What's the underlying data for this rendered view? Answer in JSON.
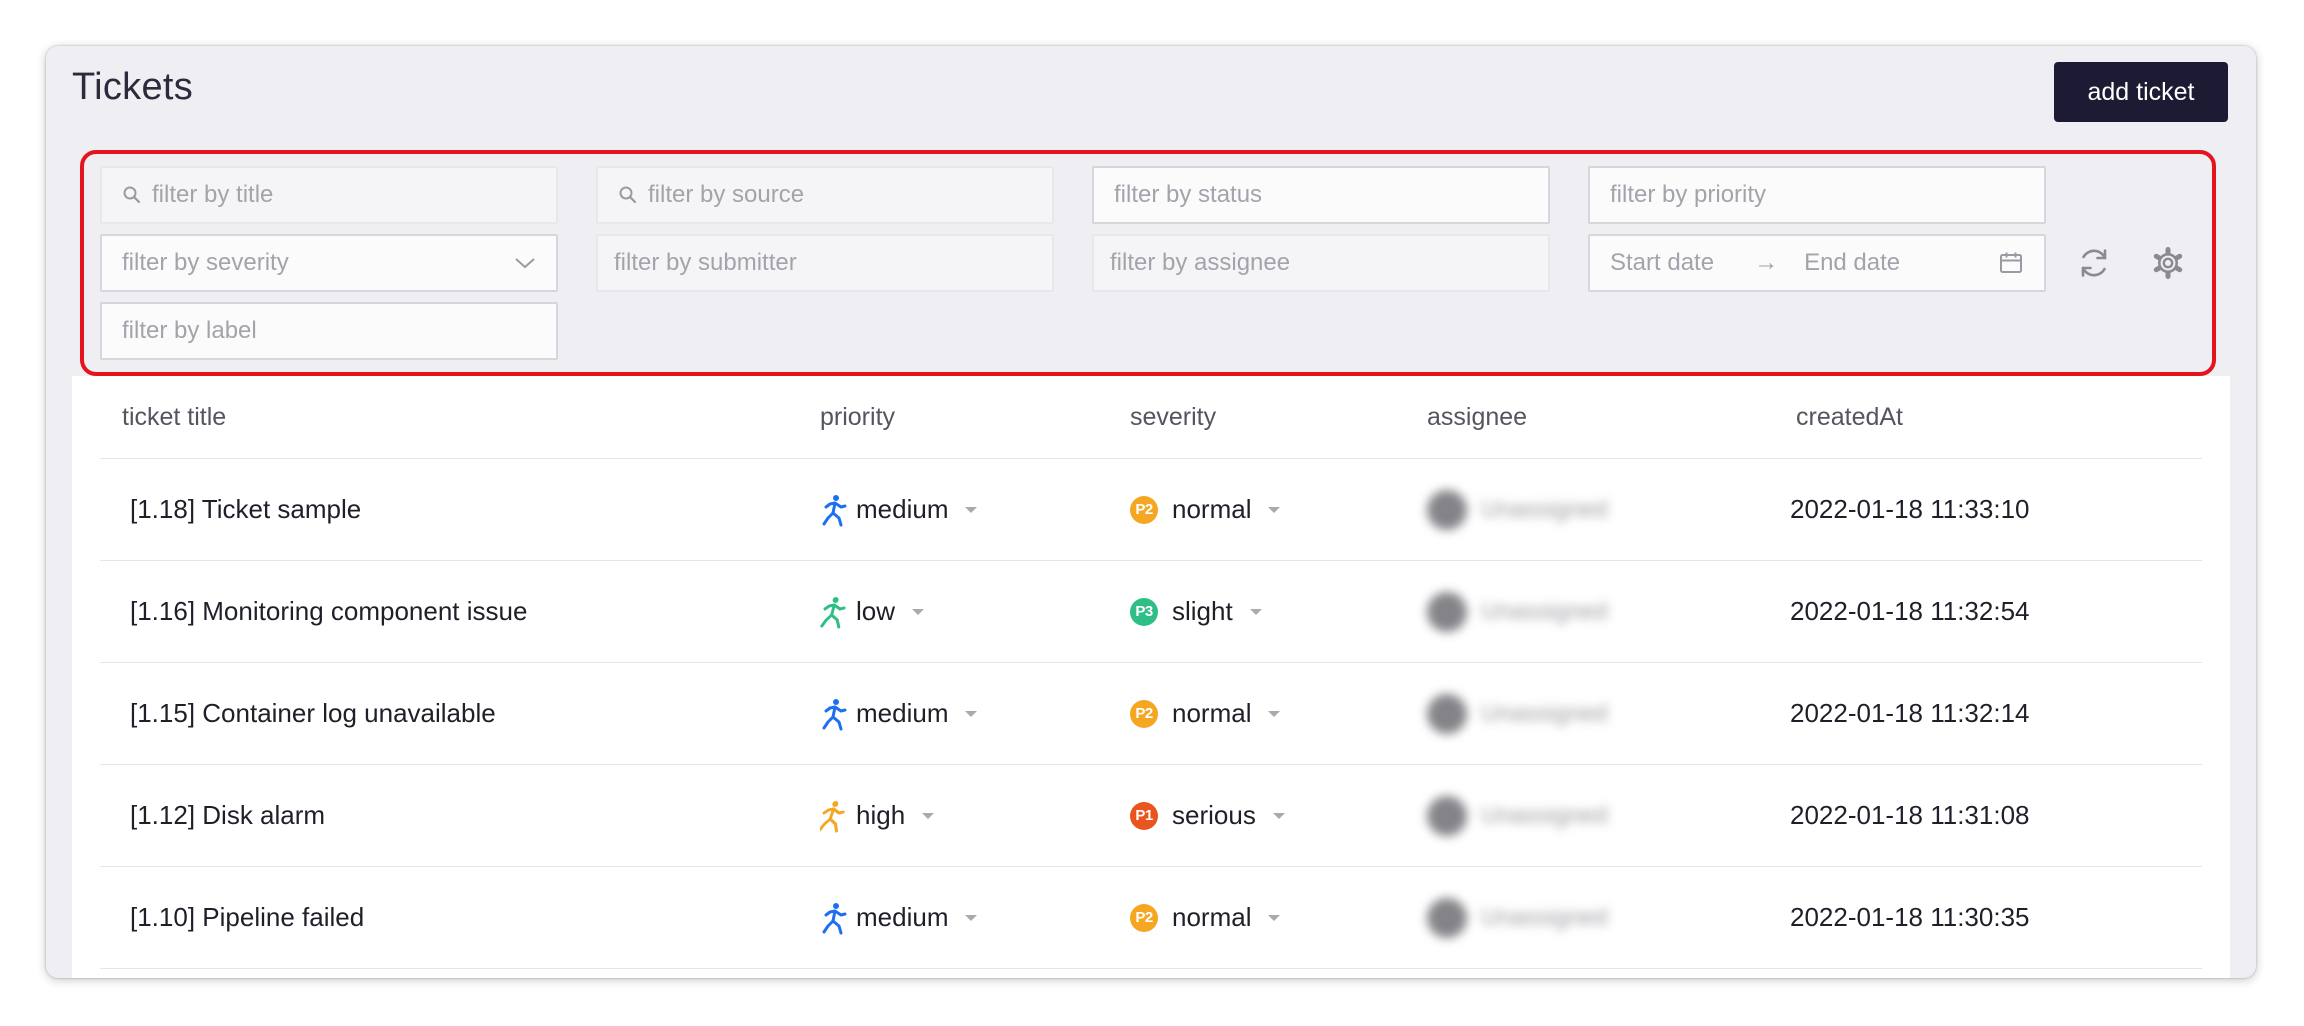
{
  "header": {
    "title": "Tickets",
    "add_button": "add ticket"
  },
  "filters": {
    "title_placeholder": "filter by title",
    "source_placeholder": "filter by source",
    "status_placeholder": "filter by status",
    "priority_placeholder": "filter by priority",
    "severity_placeholder": "filter by severity",
    "submitter_placeholder": "filter by submitter",
    "assignee_placeholder": "filter by assignee",
    "start_date_placeholder": "Start date",
    "end_date_placeholder": "End date",
    "date_separator": "→",
    "label_placeholder": "filter by label"
  },
  "table": {
    "columns": [
      "ticket title",
      "priority",
      "severity",
      "assignee",
      "createdAt"
    ],
    "rows": [
      {
        "title": "[1.18] Ticket sample",
        "priority": "medium",
        "severity_badge": "P2",
        "severity": "normal",
        "assignee": "Unassigned",
        "created_at": "2022-01-18 11:33:10"
      },
      {
        "title": "[1.16] Monitoring component issue",
        "priority": "low",
        "severity_badge": "P3",
        "severity": "slight",
        "assignee": "Unassigned",
        "created_at": "2022-01-18 11:32:54"
      },
      {
        "title": "[1.15] Container log unavailable",
        "priority": "medium",
        "severity_badge": "P2",
        "severity": "normal",
        "assignee": "Unassigned",
        "created_at": "2022-01-18 11:32:14"
      },
      {
        "title": "[1.12] Disk alarm",
        "priority": "high",
        "severity_badge": "P1",
        "severity": "serious",
        "assignee": "Unassigned",
        "created_at": "2022-01-18 11:31:08"
      },
      {
        "title": "[1.10] Pipeline failed",
        "priority": "medium",
        "severity_badge": "P2",
        "severity": "normal",
        "assignee": "Unassigned",
        "created_at": "2022-01-18 11:30:35"
      }
    ]
  },
  "icons": {
    "search": "search-icon",
    "severity_dropdown": "chevron-down-icon",
    "calendar": "calendar-icon",
    "refresh": "refresh-icon",
    "settings": "gear-icon",
    "priority": "running-person-icon",
    "dropdown": "caret-down-icon"
  },
  "colors": {
    "priority": {
      "medium": "#1d6ff2",
      "low": "#2fbf86",
      "high": "#f5a623"
    },
    "severity": {
      "P1": "#e9551f",
      "P2": "#f5a623",
      "P3": "#2fbf86"
    },
    "filter_highlight": "#e4141e",
    "primary_button": "#1d1b33"
  }
}
